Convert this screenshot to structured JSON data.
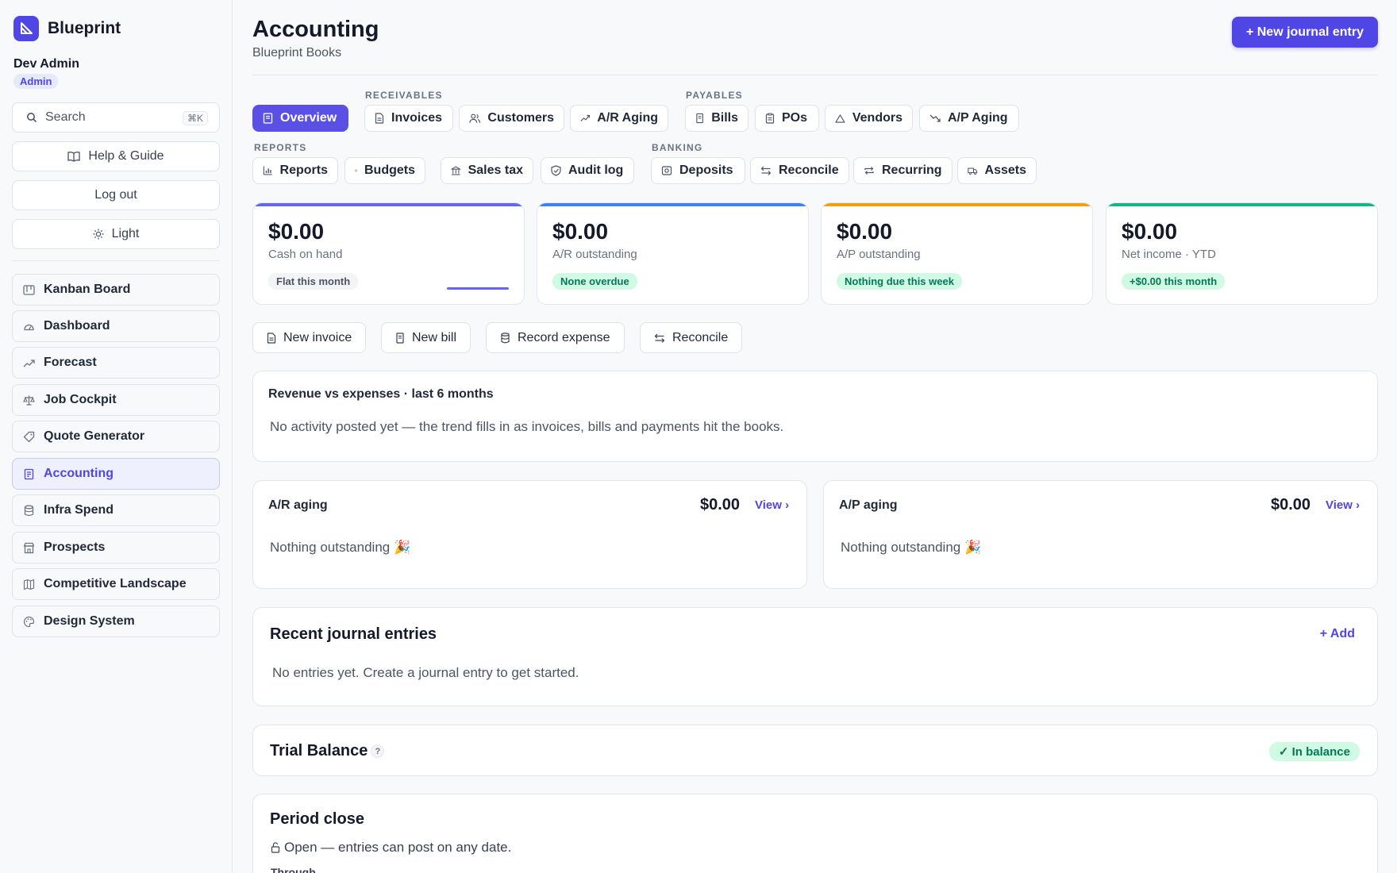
{
  "app": {
    "name": "Blueprint"
  },
  "user": {
    "name": "Dev Admin",
    "role": "Admin"
  },
  "sidebar": {
    "search_label": "Search",
    "search_shortcut": "⌘K",
    "help_label": "Help & Guide",
    "logout_label": "Log out",
    "theme_label": "Light",
    "items": [
      {
        "label": "Kanban Board",
        "icon": "kanban-icon"
      },
      {
        "label": "Dashboard",
        "icon": "gauge-icon"
      },
      {
        "label": "Forecast",
        "icon": "trend-up-icon"
      },
      {
        "label": "Job Cockpit",
        "icon": "scale-icon"
      },
      {
        "label": "Quote Generator",
        "icon": "tag-icon"
      },
      {
        "label": "Accounting",
        "icon": "ledger-icon",
        "active": true
      },
      {
        "label": "Infra Spend",
        "icon": "database-icon"
      },
      {
        "label": "Prospects",
        "icon": "store-icon"
      },
      {
        "label": "Competitive Landscape",
        "icon": "map-icon"
      },
      {
        "label": "Design System",
        "icon": "palette-icon"
      }
    ]
  },
  "header": {
    "title": "Accounting",
    "subtitle": "Blueprint Books",
    "primary_action": "+ New journal entry"
  },
  "tabs": {
    "receivables_label": "RECEIVABLES",
    "payables_label": "PAYABLES",
    "reports_label": "REPORTS",
    "banking_label": "BANKING",
    "row1": [
      "Overview",
      "Invoices",
      "Customers",
      "A/R Aging",
      "Bills",
      "POs",
      "Vendors",
      "A/P Aging"
    ],
    "row2": [
      "Reports",
      "Budgets",
      "Sales tax",
      "Audit log",
      "Deposits",
      "Reconcile",
      "Recurring",
      "Assets"
    ],
    "active": "Overview"
  },
  "kpis": [
    {
      "value": "$0.00",
      "label": "Cash on hand",
      "pill": "Flat this month",
      "accent": "#6366f1"
    },
    {
      "value": "$0.00",
      "label": "A/R outstanding",
      "pill": "None overdue",
      "accent": "#3b82f6"
    },
    {
      "value": "$0.00",
      "label": "A/P outstanding",
      "pill": "Nothing due this week",
      "accent": "#f59e0b"
    },
    {
      "value": "$0.00",
      "label": "Net income · YTD",
      "pill": "+$0.00 this month",
      "accent": "#10b981"
    }
  ],
  "quick_actions": [
    "New invoice",
    "New bill",
    "Record expense",
    "Reconcile"
  ],
  "revenue_card": {
    "title": "Revenue vs expenses · last 6 months",
    "empty": "No activity posted yet — the trend fills in as invoices, bills and payments hit the books."
  },
  "ar_aging": {
    "title": "A/R aging",
    "amount": "$0.00",
    "link": "View ›",
    "empty": "Nothing outstanding 🎉"
  },
  "ap_aging": {
    "title": "A/P aging",
    "amount": "$0.00",
    "link": "View ›",
    "empty": "Nothing outstanding 🎉"
  },
  "journal": {
    "title": "Recent journal entries",
    "add": "+ Add",
    "empty": "No entries yet. Create a journal entry to get started."
  },
  "trial_balance": {
    "title": "Trial Balance",
    "help": "?",
    "status": "✓ In balance"
  },
  "period_close": {
    "title": "Period close",
    "status": "Open — entries can post on any date.",
    "through_label": "Through"
  },
  "colors": {
    "accent": "#5046e5",
    "success_bg": "#d1fae5",
    "success_text": "#047857"
  }
}
